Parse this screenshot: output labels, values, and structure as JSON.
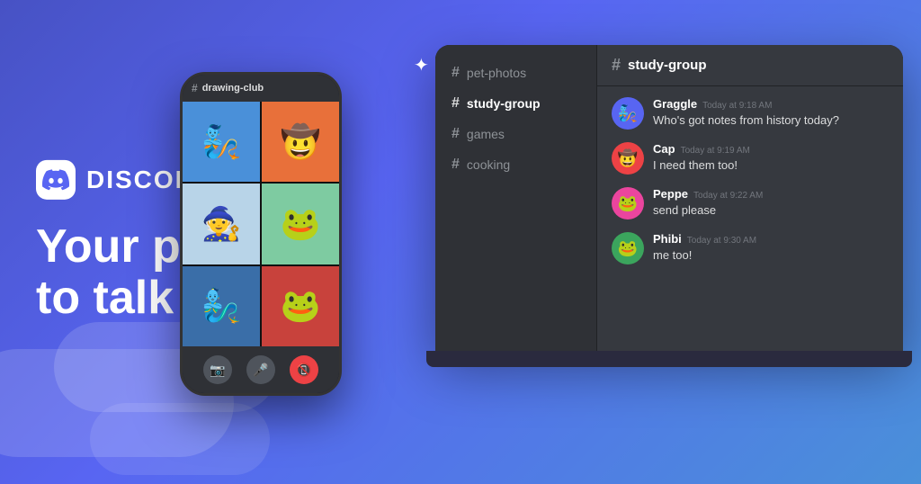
{
  "brand": {
    "name": "DISCORD",
    "tagline_line1": "Your place",
    "tagline_line2": "to talk"
  },
  "colors": {
    "bg_gradient_start": "#4752c4",
    "bg_gradient_end": "#5865f2",
    "laptop_bg": "#2f3136",
    "chat_bg": "#36393f",
    "sidebar_bg": "#2f3136",
    "accent": "#5865f2"
  },
  "phone": {
    "channel": "drawing-club"
  },
  "sidebar": {
    "channels": [
      {
        "name": "pet-photos",
        "active": false
      },
      {
        "name": "study-group",
        "active": false
      },
      {
        "name": "games",
        "active": false
      },
      {
        "name": "cooking",
        "active": false
      }
    ]
  },
  "chat": {
    "channel_name": "study-group",
    "messages": [
      {
        "username": "Graggle",
        "timestamp": "Today at 9:18 AM",
        "text": "Who's got notes from history today?",
        "avatar_emoji": "🧞"
      },
      {
        "username": "Cap",
        "timestamp": "Today at 9:19 AM",
        "text": "I need them too!",
        "avatar_emoji": "🤠"
      },
      {
        "username": "Peppe",
        "timestamp": "Today at 9:22 AM",
        "text": "send please",
        "avatar_emoji": "🐸"
      },
      {
        "username": "Phibi",
        "timestamp": "Today at 9:30 AM",
        "text": "me too!",
        "avatar_emoji": "🐸"
      }
    ]
  },
  "icons": {
    "star": "✦",
    "hash": "#",
    "camera": "📷",
    "mic_off": "🎤",
    "end_call": "📵"
  }
}
